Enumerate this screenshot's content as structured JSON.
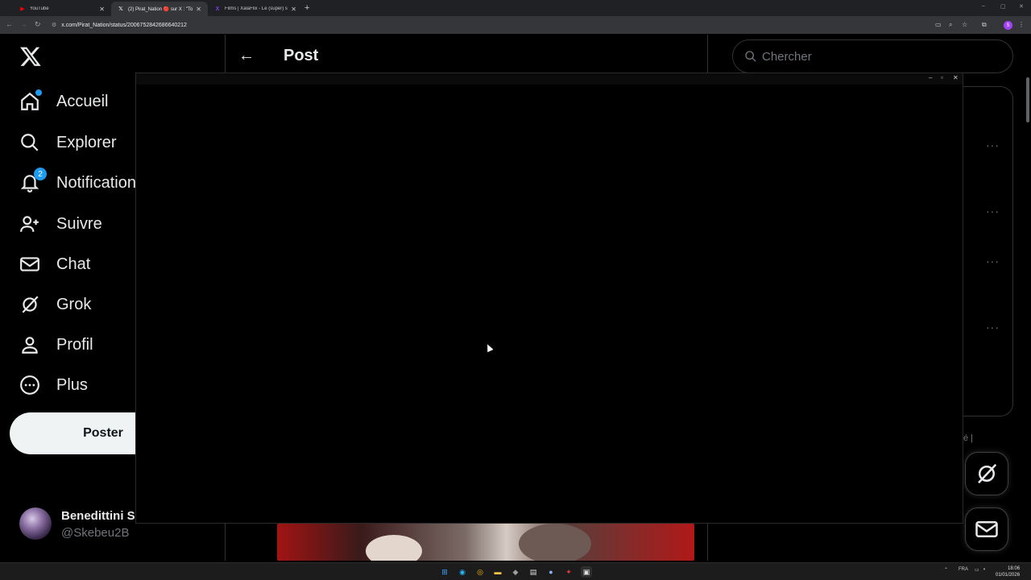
{
  "browser": {
    "tabs": [
      {
        "title": "YouTube",
        "icon": "youtube-icon"
      },
      {
        "title": "(2) Pirat_Nation 🔴 sur X : \"Tod",
        "icon": "x-icon"
      },
      {
        "title": "Films | XalaFlix - Le (super) site",
        "icon": "xalaflix-icon"
      }
    ],
    "url": "x.com/Pirat_Nation/status/2006752842686640212",
    "profile_initial": "S"
  },
  "nav": {
    "items": [
      {
        "label": "Accueil",
        "icon": "home-icon"
      },
      {
        "label": "Explorer",
        "icon": "search-icon"
      },
      {
        "label": "Notifications",
        "icon": "bell-icon",
        "badge": "2"
      },
      {
        "label": "Suivre",
        "icon": "follow-icon"
      },
      {
        "label": "Chat",
        "icon": "mail-icon"
      },
      {
        "label": "Grok",
        "icon": "grok-icon"
      },
      {
        "label": "Profil",
        "icon": "profile-icon"
      },
      {
        "label": "Plus",
        "icon": "more-circle-icon"
      }
    ],
    "post_button": "Poster"
  },
  "account": {
    "name": "Benedittini S",
    "handle": "@Skebeu2B",
    "more": "···"
  },
  "header": {
    "title": "Post"
  },
  "search": {
    "placeholder": "Chercher"
  },
  "right": {
    "more": "···",
    "footer_fragment": "é  |"
  },
  "taskbar": {
    "lang": "FRA",
    "time": "18:06",
    "date": "01/01/2026"
  },
  "colors": {
    "accent": "#1d9bf0",
    "background": "#000000",
    "post_button_bg": "#eff3f4"
  }
}
